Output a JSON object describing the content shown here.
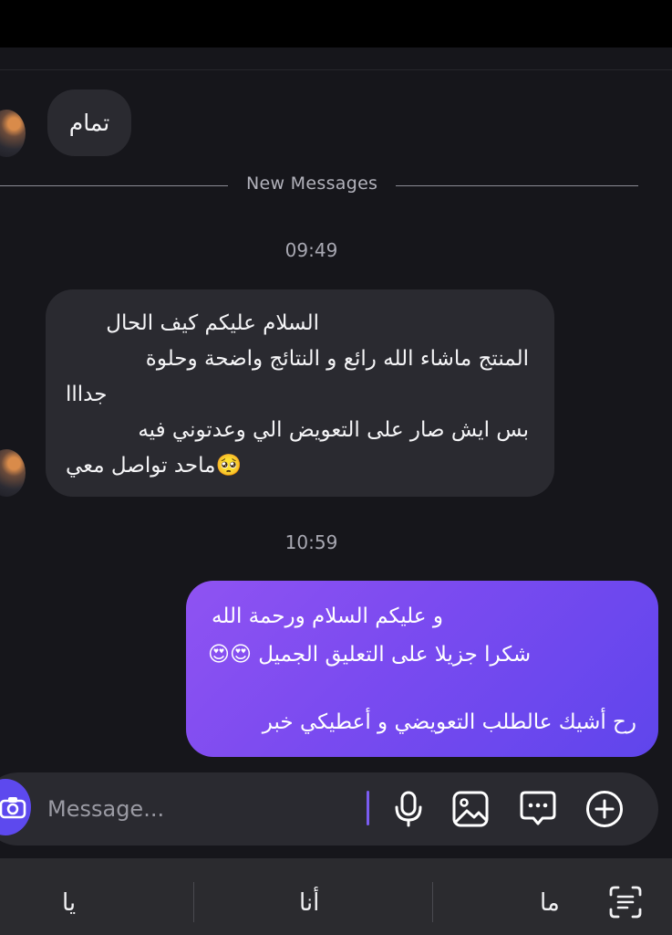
{
  "conversation": {
    "messages": [
      {
        "direction": "incoming",
        "text": "تمام"
      },
      {
        "direction": "incoming",
        "lines": [
          "السلام عليكم كيف الحال",
          "المنتج ماشاء الله رائع و النتائج واضحة  وحلوة",
          "جدااا",
          "بس ايش صار على التعويض الي وعدتوني فيه",
          "🥺ماحد تواصل معي"
        ]
      },
      {
        "direction": "outgoing",
        "lines": [
          "و عليكم السلام ورحمة الله",
          "شكرا جزيلا على التعليق الجميل 😍😍",
          "رح أشيك عالطلب التعويضي و أعطيكي خبر"
        ]
      }
    ],
    "new_messages_label": "New Messages",
    "timestamps": [
      "09:49",
      "10:59"
    ]
  },
  "composer": {
    "placeholder": "Message...",
    "icons": [
      "camera-icon",
      "microphone-icon",
      "image-icon",
      "chat-icon",
      "plus-icon"
    ],
    "accent_color": "#5d49ee"
  },
  "keyboard": {
    "suggestions": [
      "يا",
      "أنا",
      "ما"
    ],
    "icons": [
      "text-scan-icon"
    ]
  },
  "colors": {
    "background": "#16161b",
    "incoming_bubble": "#2a2a30",
    "outgoing_gradient_start": "#8f53f2",
    "outgoing_gradient_end": "#5f45ec"
  }
}
